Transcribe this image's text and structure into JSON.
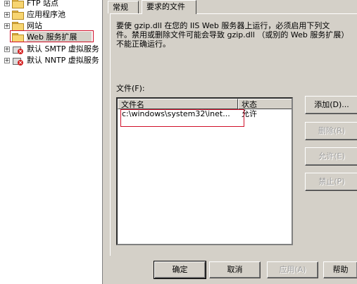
{
  "tree": {
    "items": [
      {
        "label": "FTP 站点",
        "icon": "folder-icon",
        "expander": "+"
      },
      {
        "label": "应用程序池",
        "icon": "folder-icon",
        "expander": "+"
      },
      {
        "label": "网站",
        "icon": "folder-icon",
        "expander": "+"
      },
      {
        "label": "Web 服务扩展",
        "icon": "folder-icon",
        "expander": ""
      },
      {
        "label": "默认 SMTP 虚拟服务",
        "icon": "server-stopped-icon",
        "expander": "+"
      },
      {
        "label": "默认 NNTP 虚拟服务",
        "icon": "server-stopped-icon",
        "expander": "+"
      }
    ],
    "selected": "Web 服务扩展"
  },
  "dialog": {
    "tabs": [
      {
        "label": "常规",
        "active": false
      },
      {
        "label": "要求的文件",
        "active": true
      }
    ],
    "description": "要使 gzip.dll 在您的 IIS Web 服务器上运行，必须启用下列文\n件。禁用或删除文件可能会导致 gzip.dll （或别的 Web 服务扩展）\n不能正确运行。",
    "files_label": "文件(F):",
    "columns": {
      "name": "文件名",
      "status": "状态"
    },
    "rows": [
      {
        "name": "c:\\windows\\system32\\inet...",
        "status": "允许"
      }
    ],
    "side_buttons": {
      "add": "添加(D)...",
      "remove": "删除(R)",
      "allow": "允许(E)",
      "deny": "禁止(P)"
    },
    "bottom_buttons": {
      "ok": "确定",
      "cancel": "取消",
      "apply": "应用(A)",
      "help": "帮助"
    }
  }
}
